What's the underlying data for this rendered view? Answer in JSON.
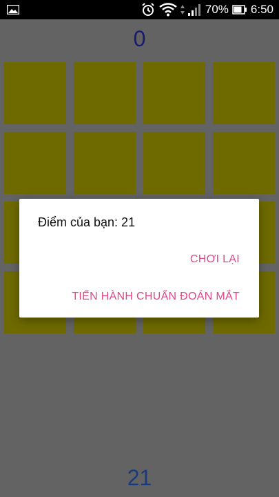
{
  "status_bar": {
    "battery_percent": "70%",
    "time": "6:50"
  },
  "game": {
    "top_score": "0",
    "bottom_score": "21",
    "tile_color": "#6e6a00"
  },
  "dialog": {
    "message": "Điểm của bạn: 21",
    "replay_label": "CHƠI LẠI",
    "guess_label": "TIẾN HÀNH CHUẨN ĐOÁN MẮT",
    "accent_color": "#e0468a"
  }
}
